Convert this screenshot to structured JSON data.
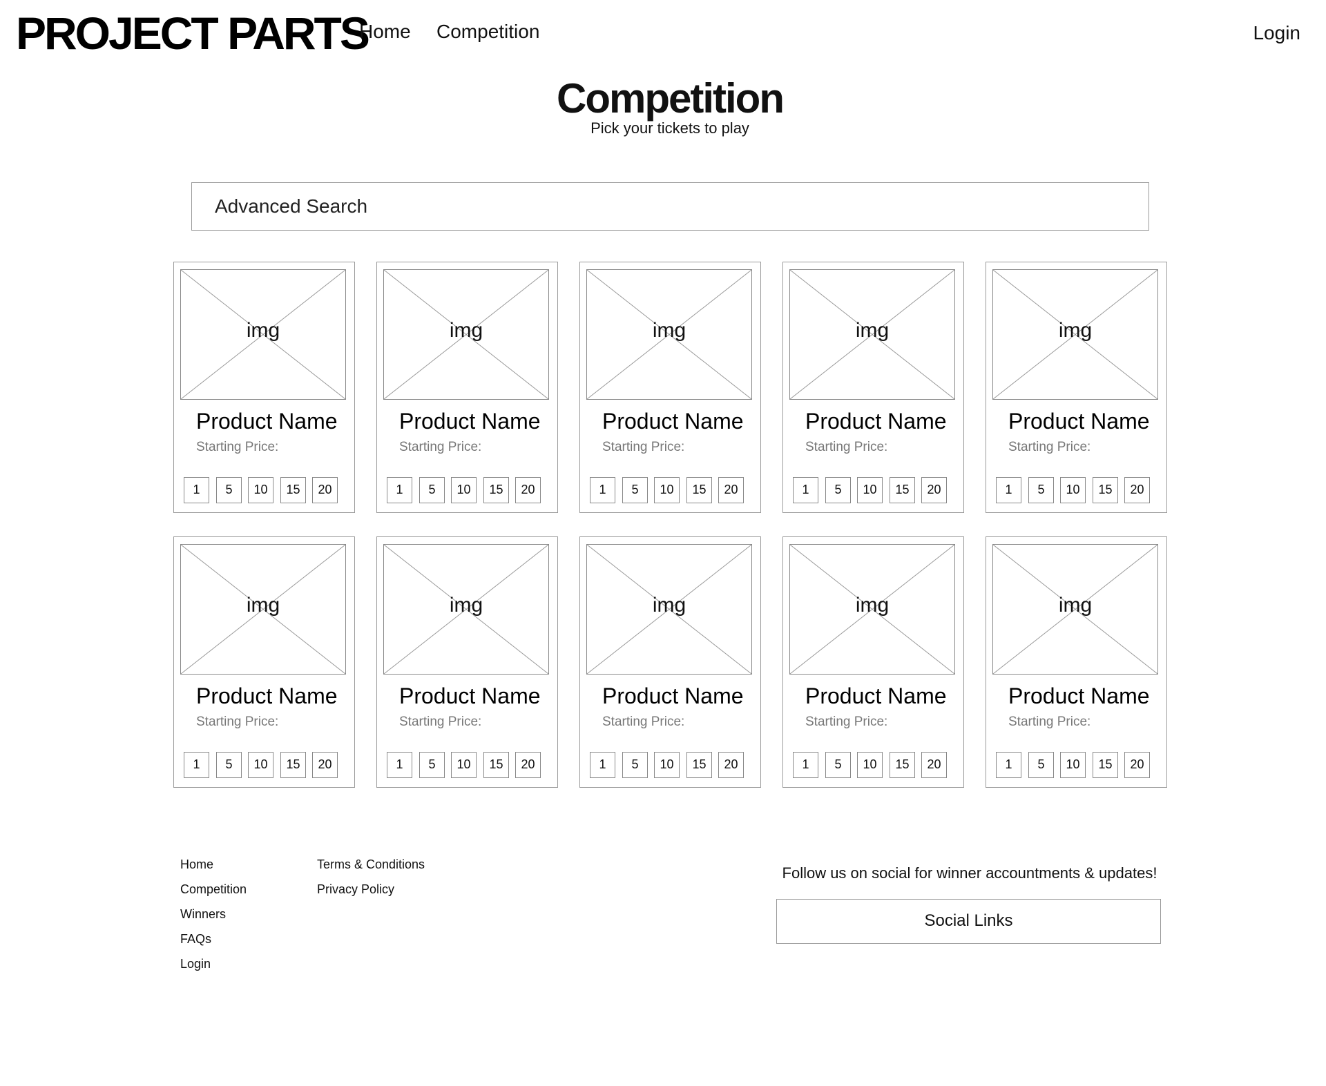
{
  "header": {
    "brand": "PROJECT PARTS",
    "nav": [
      {
        "label": "Home"
      },
      {
        "label": "Competition"
      }
    ],
    "login_label": "Login"
  },
  "main": {
    "title": "Competition",
    "subtitle": "Pick your tickets to play",
    "search_label": "Advanced Search",
    "cards": [
      {
        "img_label": "img",
        "name": "Product Name",
        "price_label": "Starting Price:",
        "tickets": [
          "1",
          "5",
          "10",
          "15",
          "20"
        ]
      },
      {
        "img_label": "img",
        "name": "Product Name",
        "price_label": "Starting Price:",
        "tickets": [
          "1",
          "5",
          "10",
          "15",
          "20"
        ]
      },
      {
        "img_label": "img",
        "name": "Product Name",
        "price_label": "Starting Price:",
        "tickets": [
          "1",
          "5",
          "10",
          "15",
          "20"
        ]
      },
      {
        "img_label": "img",
        "name": "Product Name",
        "price_label": "Starting Price:",
        "tickets": [
          "1",
          "5",
          "10",
          "15",
          "20"
        ]
      },
      {
        "img_label": "img",
        "name": "Product Name",
        "price_label": "Starting Price:",
        "tickets": [
          "1",
          "5",
          "10",
          "15",
          "20"
        ]
      },
      {
        "img_label": "img",
        "name": "Product Name",
        "price_label": "Starting Price:",
        "tickets": [
          "1",
          "5",
          "10",
          "15",
          "20"
        ]
      },
      {
        "img_label": "img",
        "name": "Product Name",
        "price_label": "Starting Price:",
        "tickets": [
          "1",
          "5",
          "10",
          "15",
          "20"
        ]
      },
      {
        "img_label": "img",
        "name": "Product Name",
        "price_label": "Starting Price:",
        "tickets": [
          "1",
          "5",
          "10",
          "15",
          "20"
        ]
      },
      {
        "img_label": "img",
        "name": "Product Name",
        "price_label": "Starting Price:",
        "tickets": [
          "1",
          "5",
          "10",
          "15",
          "20"
        ]
      },
      {
        "img_label": "img",
        "name": "Product Name",
        "price_label": "Starting Price:",
        "tickets": [
          "1",
          "5",
          "10",
          "15",
          "20"
        ]
      }
    ]
  },
  "footer": {
    "links_col1": [
      "Home",
      "Competition",
      "Winners",
      "FAQs",
      "Login"
    ],
    "links_col2": [
      "Terms & Conditions",
      "Privacy Policy"
    ],
    "social_tagline": "Follow us on social for winner accountments & updates!",
    "social_links_label": "Social Links"
  }
}
